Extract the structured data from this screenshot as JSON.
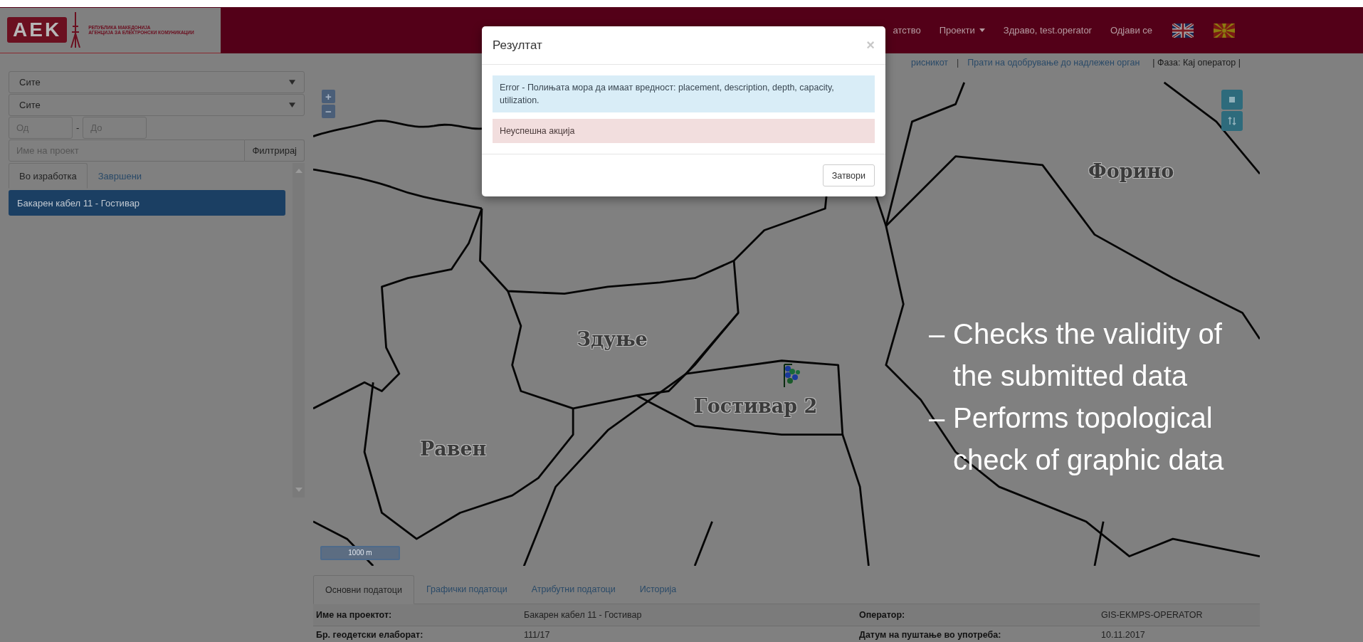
{
  "header": {
    "logo": {
      "mark": "AEK",
      "line_1": "РЕПУБЛИКА МАКЕДОНИЈА",
      "line_2": "АГЕНЦИЈА ЗА ЕЛЕКТРОНСКИ КОМУНИКАЦИИ"
    },
    "nav": [
      {
        "label": "атство",
        "dropdown": false
      },
      {
        "label": "Проекти",
        "dropdown": true
      },
      {
        "label": "Здраво, test.operator",
        "dropdown": false
      },
      {
        "label": "Одјави се",
        "dropdown": false
      }
    ],
    "languages": [
      {
        "kind": "uk"
      },
      {
        "kind": "mk"
      }
    ]
  },
  "action_bar": {
    "links": [
      "рисникот",
      "Прати на одобрување до надлежен орган"
    ],
    "separator": "|",
    "phase": "| Фаза: Кај оператор |"
  },
  "filters": {
    "selects": [
      "Сите",
      "Сите"
    ],
    "from": {
      "placeholder": "Од"
    },
    "dash": "-",
    "to": {
      "placeholder": "До"
    },
    "project": {
      "placeholder": "Име на проект"
    },
    "filter_button": "Филтрирај"
  },
  "project_tabs": [
    {
      "label": "Во изработка",
      "selected": true
    },
    {
      "label": "Завршени",
      "selected": false
    }
  ],
  "projects": [
    {
      "name": "Бакарен кабел 11 - Гостивар",
      "selected": true
    }
  ],
  "map": {
    "zoom_in": "+",
    "zoom_out": "−",
    "labels": [
      "Форино",
      "Здуње",
      "Гостивар 2",
      "Равен"
    ],
    "scale": "1000 m"
  },
  "detail_tabs": [
    {
      "label": "Основни податоци",
      "selected": true
    },
    {
      "label": "Графички податоци",
      "selected": false
    },
    {
      "label": "Атрибутни податоци",
      "selected": false
    },
    {
      "label": "Историја",
      "selected": false
    }
  ],
  "details": [
    {
      "cells": [
        "Име на проектот:",
        "Бакарен кабел 11 - Гостивар",
        "Оператор:",
        "GIS-EKMPS-OPERATOR"
      ]
    },
    {
      "cells": [
        "Бр. геодетски елаборат:",
        "111/17",
        "Датум на пуштање во употреба:",
        "10.11.2017"
      ]
    }
  ],
  "modal": {
    "title": "Резултат",
    "close": "×",
    "messages": [
      {
        "kind": "info",
        "text": "Error - Полињата мора да имаат вредност: placement, description, depth, capacity, utilization."
      },
      {
        "kind": "danger",
        "text": "Неуспешна акција"
      }
    ],
    "button": "Затвори"
  },
  "slide_bullets": [
    {
      "dash": "–",
      "text": "Checks the validity of the submitted data"
    },
    {
      "dash": "–",
      "text": "Performs topological check of graphic data"
    }
  ]
}
